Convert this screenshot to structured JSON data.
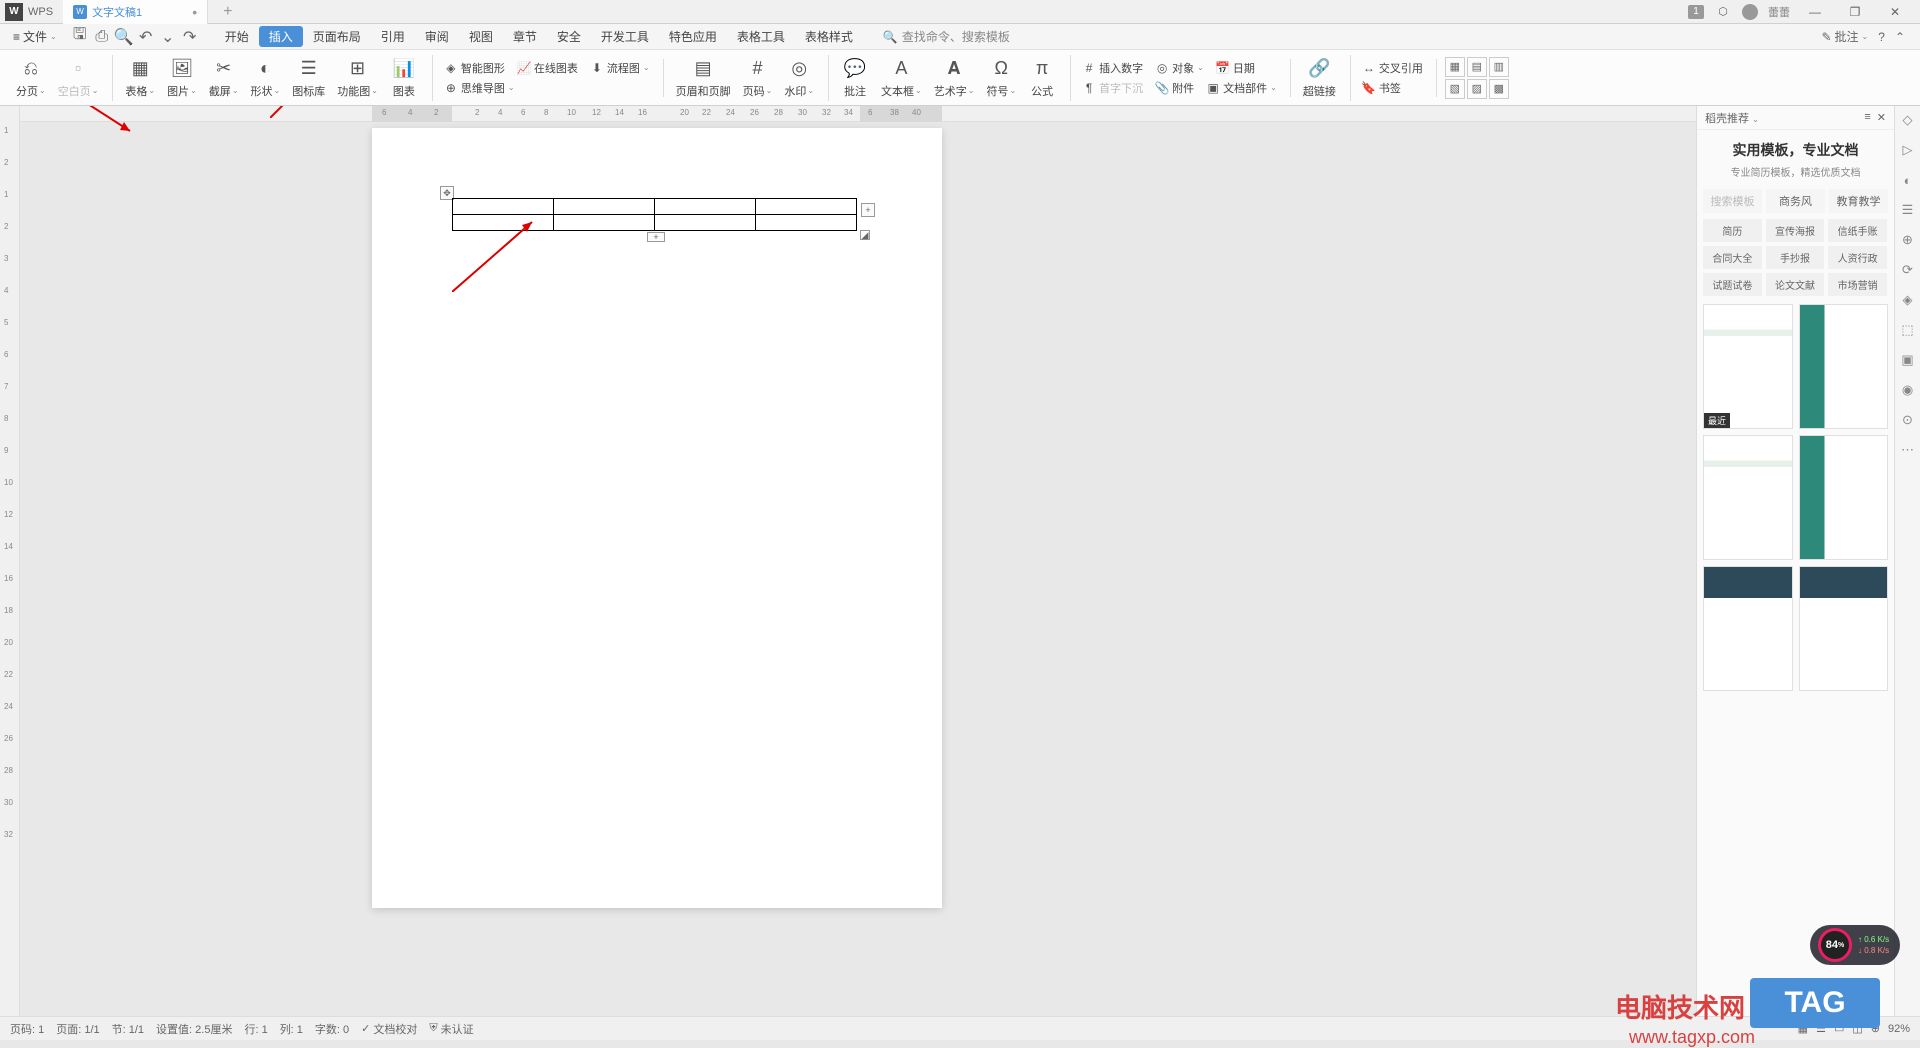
{
  "titlebar": {
    "app_name": "WPS",
    "tab_name": "文字文稿1",
    "tab_modified": "•",
    "add": "+",
    "badge": "1",
    "user": "蕾蕾"
  },
  "menubar": {
    "file": "文件",
    "tabs": [
      "开始",
      "插入",
      "页面布局",
      "引用",
      "审阅",
      "视图",
      "章节",
      "安全",
      "开发工具",
      "特色应用",
      "表格工具",
      "表格样式"
    ],
    "active_index": 1,
    "search_label": "查找命令、",
    "search_placeholder": "搜索模板",
    "approve": "批注"
  },
  "ribbon": {
    "groups": [
      {
        "type": "large",
        "items": [
          {
            "label": "分页",
            "icon": "⎌",
            "caret": true
          },
          {
            "label": "空白页",
            "icon": "▫",
            "caret": true,
            "disabled": true
          }
        ]
      },
      {
        "type": "large",
        "items": [
          {
            "label": "表格",
            "icon": "▦",
            "caret": true
          },
          {
            "label": "图片",
            "icon": "🖼",
            "caret": true
          },
          {
            "label": "截屏",
            "icon": "✂",
            "caret": true
          },
          {
            "label": "形状",
            "icon": "◐",
            "caret": true
          },
          {
            "label": "图标库",
            "icon": "☰"
          },
          {
            "label": "功能图",
            "icon": "⊞",
            "caret": true
          },
          {
            "label": "图表",
            "icon": "📊"
          }
        ]
      },
      {
        "type": "small",
        "rows": [
          [
            {
              "label": "智能图形",
              "icon": "◈"
            },
            {
              "label": "在线图表",
              "icon": "📈"
            },
            {
              "label": "流程图",
              "icon": "⬇",
              "caret": true
            }
          ],
          [
            {
              "label": "思维导图",
              "icon": "⊕",
              "caret": true
            }
          ]
        ]
      },
      {
        "type": "large",
        "items": [
          {
            "label": "页眉和页脚",
            "icon": "▤"
          },
          {
            "label": "页码",
            "icon": "#",
            "caret": true
          },
          {
            "label": "水印",
            "icon": "◎",
            "caret": true
          }
        ]
      },
      {
        "type": "large",
        "items": [
          {
            "label": "批注",
            "icon": "💬"
          },
          {
            "label": "文本框",
            "icon": "A",
            "caret": true
          },
          {
            "label": "艺术字",
            "icon": "𝐀",
            "caret": true
          },
          {
            "label": "符号",
            "icon": "Ω",
            "caret": true
          },
          {
            "label": "公式",
            "icon": "π"
          }
        ]
      },
      {
        "type": "small",
        "rows": [
          [
            {
              "label": "插入数字",
              "icon": "#"
            },
            {
              "label": "对象",
              "icon": "◎",
              "caret": true
            },
            {
              "label": "日期",
              "icon": "📅"
            }
          ],
          [
            {
              "label": "首字下沉",
              "icon": "¶",
              "disabled": true
            },
            {
              "label": "附件",
              "icon": "📎"
            },
            {
              "label": "文档部件",
              "icon": "▣",
              "caret": true
            }
          ]
        ]
      },
      {
        "type": "large",
        "items": [
          {
            "label": "超链接",
            "icon": "🔗"
          }
        ]
      },
      {
        "type": "small",
        "rows": [
          [
            {
              "label": "交叉引用",
              "icon": "↔"
            }
          ],
          [
            {
              "label": "书签",
              "icon": "🔖"
            }
          ]
        ]
      },
      {
        "type": "grid",
        "items": [
          "▦",
          "▤",
          "▥",
          "▧",
          "▨",
          "▩"
        ]
      }
    ]
  },
  "hruler_numbers": [
    "6",
    "4",
    "2",
    "2",
    "4",
    "6",
    "8",
    "10",
    "12",
    "14",
    "16",
    "20",
    "22",
    "24",
    "26",
    "28",
    "30",
    "32",
    "34",
    "6",
    "38",
    "40"
  ],
  "vruler_numbers": [
    "1",
    "2",
    "1",
    "2",
    "3",
    "4",
    "5",
    "6",
    "7",
    "8",
    "9",
    "10",
    "12",
    "14",
    "16",
    "18",
    "20",
    "22",
    "24",
    "26",
    "28",
    "30",
    "32"
  ],
  "panel": {
    "header": "稻壳推荐",
    "title": "实用模板，专业文档",
    "subtitle": "专业简历模板，精选优质文档",
    "tabs": [
      "搜索模板",
      "商务风",
      "教育教学"
    ],
    "tags": [
      "简历",
      "宣传海报",
      "信纸手账",
      "合同大全",
      "手抄报",
      "人资行政",
      "试题试卷",
      "论文文献",
      "市场营销"
    ],
    "recent": "最近"
  },
  "sidebar_icons": [
    "◇",
    "▷",
    "◐",
    "☰",
    "⊕",
    "⟳",
    "◈",
    "⬚",
    "▣",
    "◉",
    "⊙",
    "⋯"
  ],
  "statusbar": {
    "page_code": "页码: 1",
    "page": "页面: 1/1",
    "section": "节: 1/1",
    "position": "设置值: 2.5厘米",
    "line": "行: 1",
    "column": "列: 1",
    "words": "字数: 0",
    "spellcheck": "文档校对",
    "cert": "未认证",
    "zoom": "92%"
  },
  "overlay": {
    "perf": "84",
    "perf_unit": "%",
    "up": "0.6 K/s",
    "down": "0.8 K/s",
    "watermark1": "电脑技术网",
    "watermark2": "www.tagxp.com",
    "tag": "TAG"
  }
}
